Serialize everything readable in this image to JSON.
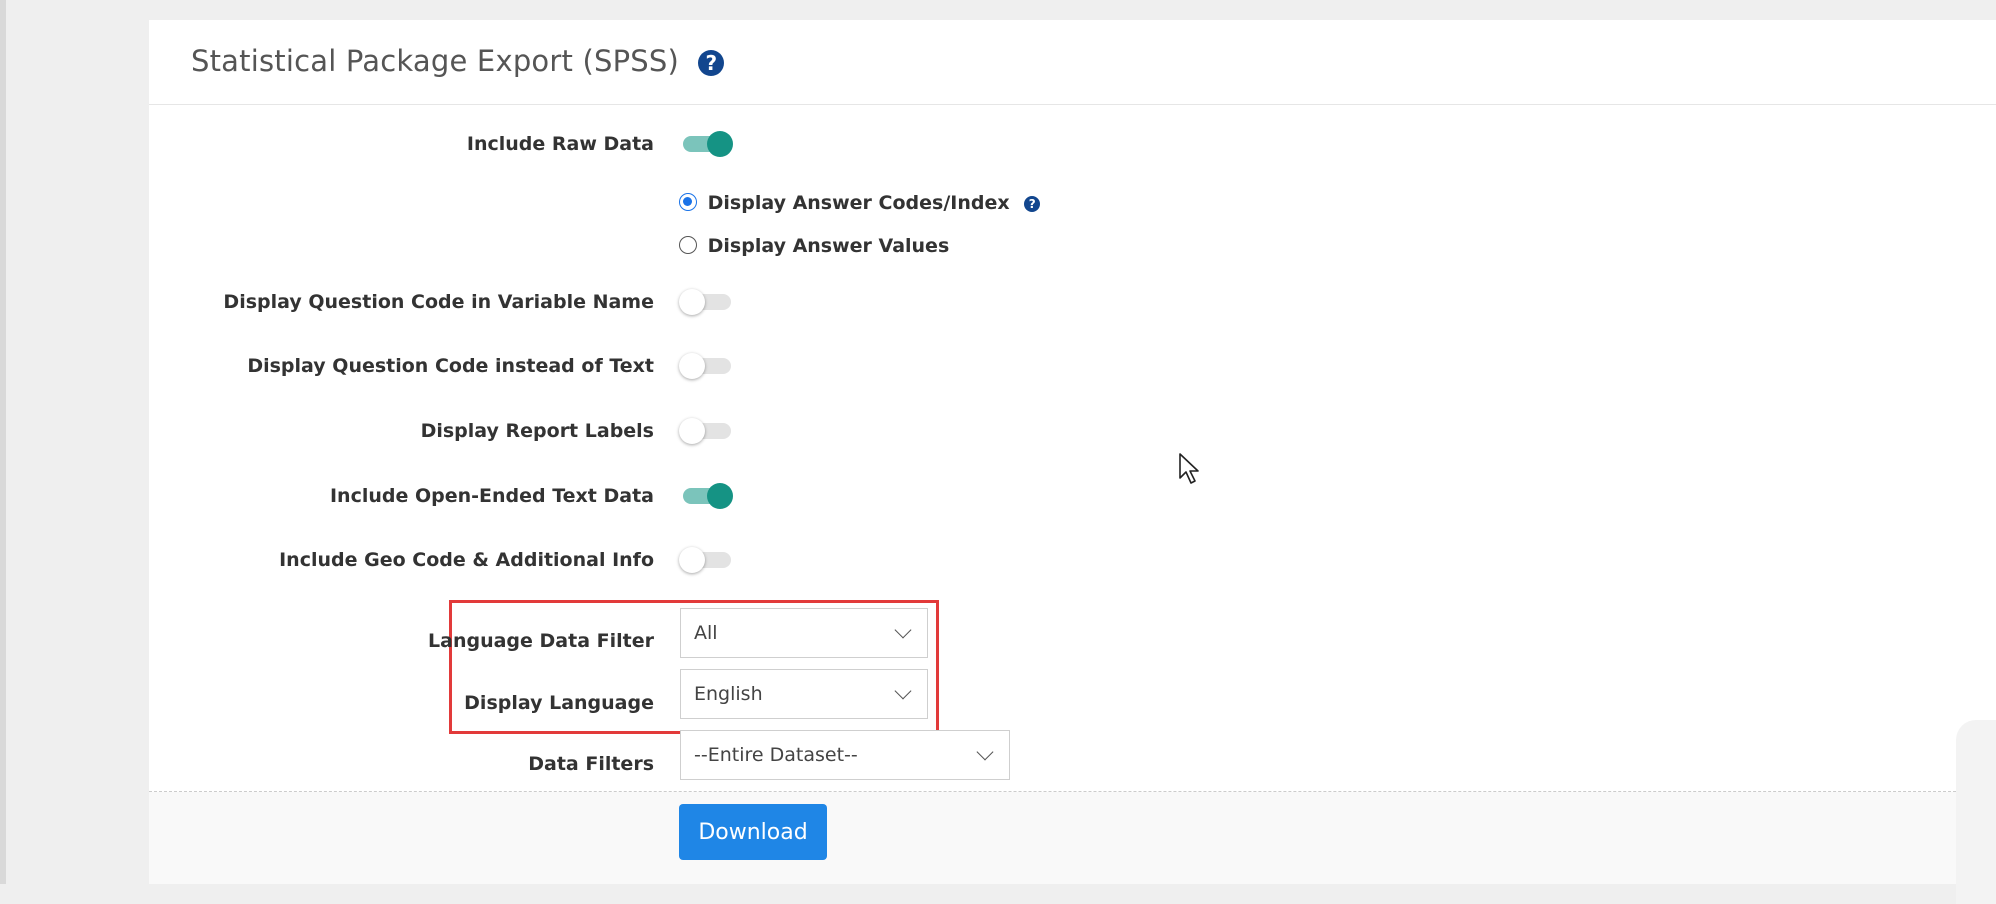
{
  "panel": {
    "title": "Statistical Package Export (SPSS)",
    "help_icon": "?"
  },
  "rows": {
    "include_raw_data": {
      "label": "Include Raw Data",
      "on": true
    },
    "answer_mode": {
      "codes_label": "Display Answer Codes/Index",
      "values_label": "Display Answer Values",
      "selected": "codes"
    },
    "question_code_variable": {
      "label": "Display Question Code in Variable Name",
      "on": false
    },
    "question_code_text": {
      "label": "Display Question Code instead of Text",
      "on": false
    },
    "report_labels": {
      "label": "Display Report Labels",
      "on": false
    },
    "open_ended": {
      "label": "Include Open-Ended Text Data",
      "on": true
    },
    "geo_code": {
      "label": "Include Geo Code & Additional Info",
      "on": false
    },
    "language_filter": {
      "label": "Language Data Filter",
      "value": "All"
    },
    "display_language": {
      "label": "Display Language",
      "value": "English"
    },
    "data_filters": {
      "label": "Data Filters",
      "value": "--Entire Dataset--"
    }
  },
  "actions": {
    "download_label": "Download"
  },
  "colors": {
    "toggle_on": "#159384",
    "highlight": "#e23a3a",
    "button": "#1f86e6",
    "help_icon": "#12468e"
  }
}
